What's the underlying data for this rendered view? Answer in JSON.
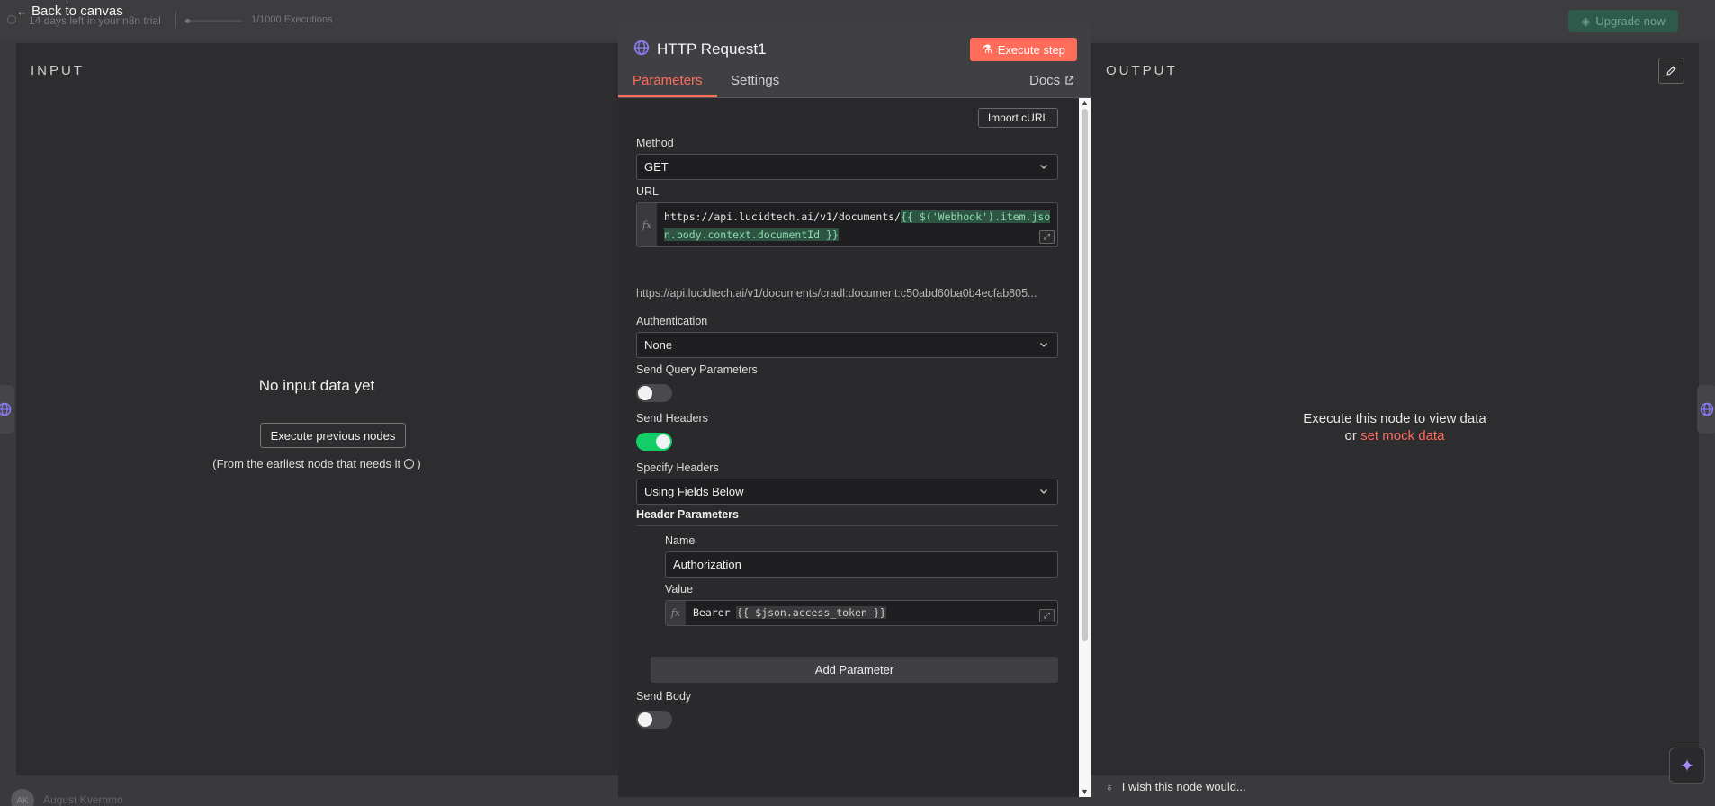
{
  "background": {
    "trial_text": "14 days left in your n8n trial",
    "executions": "1/1000 Executions",
    "upgrade_label": "Upgrade now",
    "user_initials": "AK",
    "user_name": "August Kvernmo"
  },
  "ndv": {
    "back_label": "Back to canvas",
    "input": {
      "title": "INPUT",
      "empty_title": "No input data yet",
      "execute_previous_label": "Execute previous nodes",
      "hint_prefix": "(From the earliest node that needs it",
      "hint_suffix": ")"
    },
    "output": {
      "title": "OUTPUT",
      "message": "Execute this node to view data",
      "or_text": "or",
      "mock_link": "set mock data"
    },
    "feedback_placeholder": "I wish this node would..."
  },
  "node": {
    "title": "HTTP Request1",
    "execute_label": "Execute step",
    "tabs": [
      {
        "label": "Parameters",
        "active": true
      },
      {
        "label": "Settings",
        "active": false
      }
    ],
    "docs_label": "Docs",
    "accent_color": "#ff6d5a",
    "icon": "globe-icon"
  },
  "params": {
    "import_curl_label": "Import cURL",
    "method": {
      "label": "Method",
      "value": "GET"
    },
    "url": {
      "label": "URL",
      "static_part": "https://api.lucidtech.ai/v1/documents/",
      "expression_part": "{{ $('Webhook').item.json.body.context.documentId }}",
      "preview": "https://api.lucidtech.ai/v1/documents/cradl:document:c50abd60ba0b4ecfab805..."
    },
    "authentication": {
      "label": "Authentication",
      "value": "None"
    },
    "send_query": {
      "label": "Send Query Parameters",
      "enabled": false
    },
    "send_headers": {
      "label": "Send Headers",
      "enabled": true
    },
    "specify_headers": {
      "label": "Specify Headers",
      "value": "Using Fields Below"
    },
    "header_parameters": {
      "title": "Header Parameters",
      "name_label": "Name",
      "name_value": "Authorization",
      "value_label": "Value",
      "value_static": "Bearer ",
      "value_expression": "{{ $json.access_token }}"
    },
    "add_parameter_label": "Add Parameter",
    "send_body": {
      "label": "Send Body",
      "enabled": false
    }
  }
}
